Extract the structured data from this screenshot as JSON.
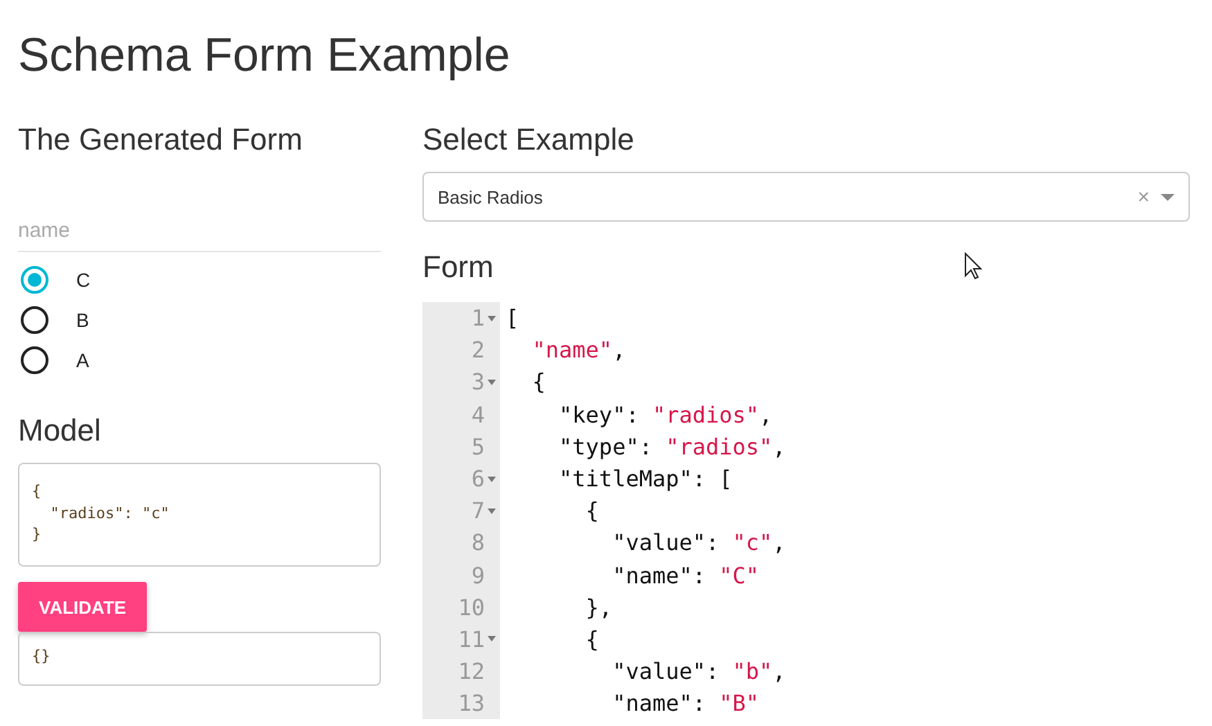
{
  "title": "Schema Form Example",
  "generated_form": {
    "heading": "The Generated Form",
    "field_label": "name",
    "radios": [
      {
        "label": "C",
        "selected": true
      },
      {
        "label": "B",
        "selected": false
      },
      {
        "label": "A",
        "selected": false
      }
    ]
  },
  "model": {
    "heading": "Model",
    "text": "{\n  \"radios\": \"c\"\n}",
    "validate_button": "VALIDATE",
    "validation_result": "{}"
  },
  "select_example": {
    "heading": "Select Example",
    "value": "Basic Radios",
    "clear": "×"
  },
  "form_editor": {
    "heading": "Form",
    "lines": [
      {
        "number": "1",
        "foldable": true,
        "tokens": [
          {
            "kind": "plain",
            "text": "["
          }
        ]
      },
      {
        "number": "2",
        "foldable": false,
        "tokens": [
          {
            "kind": "string",
            "text": "  \"name\""
          },
          {
            "kind": "plain",
            "text": ","
          }
        ]
      },
      {
        "number": "3",
        "foldable": true,
        "tokens": [
          {
            "kind": "plain",
            "text": "  {"
          }
        ]
      },
      {
        "number": "4",
        "foldable": false,
        "tokens": [
          {
            "kind": "plain",
            "text": "    \"key\": "
          },
          {
            "kind": "string",
            "text": "\"radios\""
          },
          {
            "kind": "plain",
            "text": ","
          }
        ]
      },
      {
        "number": "5",
        "foldable": false,
        "tokens": [
          {
            "kind": "plain",
            "text": "    \"type\": "
          },
          {
            "kind": "string",
            "text": "\"radios\""
          },
          {
            "kind": "plain",
            "text": ","
          }
        ]
      },
      {
        "number": "6",
        "foldable": true,
        "tokens": [
          {
            "kind": "plain",
            "text": "    \"titleMap\": ["
          }
        ]
      },
      {
        "number": "7",
        "foldable": true,
        "tokens": [
          {
            "kind": "plain",
            "text": "      {"
          }
        ]
      },
      {
        "number": "8",
        "foldable": false,
        "tokens": [
          {
            "kind": "plain",
            "text": "        \"value\": "
          },
          {
            "kind": "string",
            "text": "\"c\""
          },
          {
            "kind": "plain",
            "text": ","
          }
        ]
      },
      {
        "number": "9",
        "foldable": false,
        "tokens": [
          {
            "kind": "plain",
            "text": "        \"name\": "
          },
          {
            "kind": "string",
            "text": "\"C\""
          }
        ]
      },
      {
        "number": "10",
        "foldable": false,
        "tokens": [
          {
            "kind": "plain",
            "text": "      },"
          }
        ]
      },
      {
        "number": "11",
        "foldable": true,
        "tokens": [
          {
            "kind": "plain",
            "text": "      {"
          }
        ]
      },
      {
        "number": "12",
        "foldable": false,
        "tokens": [
          {
            "kind": "plain",
            "text": "        \"value\": "
          },
          {
            "kind": "string",
            "text": "\"b\""
          },
          {
            "kind": "plain",
            "text": ","
          }
        ]
      },
      {
        "number": "13",
        "foldable": false,
        "tokens": [
          {
            "kind": "plain",
            "text": "        \"name\": "
          },
          {
            "kind": "string",
            "text": "\"B\""
          }
        ]
      }
    ]
  }
}
